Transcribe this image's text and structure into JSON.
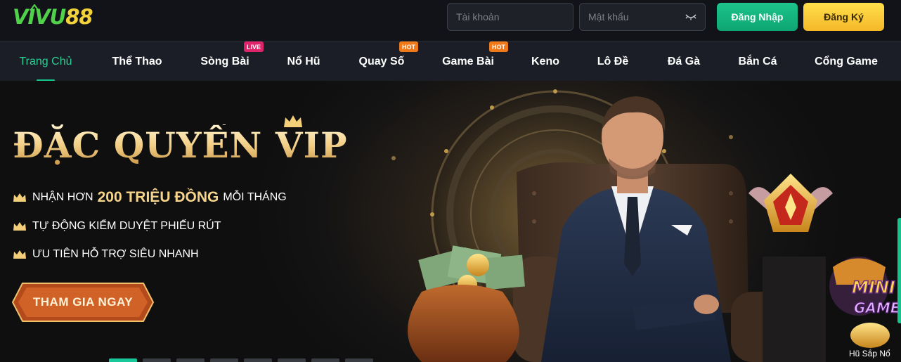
{
  "logo": {
    "text_main": "VIVU",
    "text_num": "88"
  },
  "header": {
    "username_placeholder": "Tài khoản",
    "password_placeholder": "Mật khẩu",
    "login_label": "Đăng Nhập",
    "register_label": "Đăng Ký"
  },
  "nav": {
    "items": [
      {
        "label": "Trang Chủ",
        "active": true
      },
      {
        "label": "Thể Thao"
      },
      {
        "label": "Sòng Bài",
        "badge": "LIVE"
      },
      {
        "label": "Nổ Hũ"
      },
      {
        "label": "Quay Số",
        "badge": "HOT"
      },
      {
        "label": "Game Bài",
        "badge": "HOT"
      },
      {
        "label": "Keno"
      },
      {
        "label": "Lô Đề"
      },
      {
        "label": "Đá Gà"
      },
      {
        "label": "Bắn Cá"
      },
      {
        "label": "Cổng Game"
      }
    ]
  },
  "banner": {
    "headline": "ĐẶC QUYỀN VIP",
    "perk1_prefix": "NHẬN HƠN",
    "perk1_highlight": "200 TRIỆU ĐỒNG",
    "perk1_suffix": "MỖI THÁNG",
    "perk2": "TỰ ĐỘNG KIỂM DUYỆT PHIẾU RÚT",
    "perk3": "ƯU TIÊN HỖ TRỢ SIÊU NHANH",
    "cta_label": "THAM GIA NGAY",
    "mini_game_text": "MINI GAME",
    "jackpot_label": "Hũ Sắp Nổ",
    "slide_count": 8,
    "active_slide": 1
  },
  "colors": {
    "accent_green": "#16c48a",
    "accent_gold": "#f5b82a",
    "badge_live": "#e0246b",
    "badge_hot": "#f07a1a"
  },
  "icons": [
    "crown-icon",
    "eye-icon",
    "trophy-medal-icon",
    "money-bag-icon"
  ]
}
